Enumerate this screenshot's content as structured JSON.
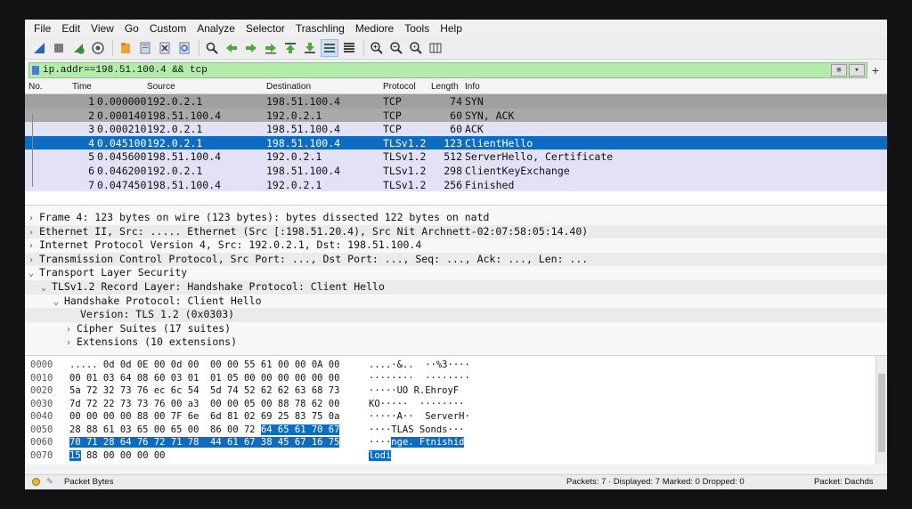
{
  "menu": [
    "File",
    "Edit",
    "View",
    "Go",
    "Custom",
    "Analyze",
    "Selector",
    "Traschling",
    "Mediore",
    "Tools",
    "Help"
  ],
  "filter": {
    "value": "ip.addr==198.51.100.4 && tcp"
  },
  "columns": {
    "no": "No.",
    "time": "Time",
    "source": "Source",
    "destination": "Destination",
    "protocol": "Protocol",
    "length": "Length",
    "info": "Info"
  },
  "packets": [
    {
      "no": "1",
      "time": "0.000000",
      "src": "192.0.2.1",
      "dst": "198.51.100.4",
      "proto": "TCP",
      "len": "74",
      "info": "SYN"
    },
    {
      "no": "2",
      "time": "0.000140",
      "src": "198.51.100.4",
      "dst": "192.0.2.1",
      "proto": "TCP",
      "len": "60",
      "info": "SYN, ACK"
    },
    {
      "no": "3",
      "time": "0.000210",
      "src": "192.0.2.1",
      "dst": "198.51.100.4",
      "proto": "TCP",
      "len": "60",
      "info": "ACK"
    },
    {
      "no": "4",
      "time": "0.045100",
      "src": "192.0.2.1",
      "dst": "198.51.100.4",
      "proto": "TLSv1.2",
      "len": "123",
      "info": "ClientHello"
    },
    {
      "no": "5",
      "time": "0.045600",
      "src": "198.51.100.4",
      "dst": "192.0.2.1",
      "proto": "TLSv1.2",
      "len": "512",
      "info": "ServerHello, Certificate"
    },
    {
      "no": "6",
      "time": "0.046200",
      "src": "192.0.2.1",
      "dst": "198.51.100.4",
      "proto": "TLSv1.2",
      "len": "298",
      "info": "ClientKeyExchange"
    },
    {
      "no": "7",
      "time": "0.047450",
      "src": "198.51.100.4",
      "dst": "192.0.2.1",
      "proto": "TLSv1.2",
      "len": "256",
      "info": "Finished"
    }
  ],
  "details": [
    "Frame 4: 123 bytes on wire (123 bytes): bytes dissected 122 bytes on natd",
    "Ethernet II, Src: ..... Ethernet (Src [:198.51.20.4), Src Nit Archnett-02:07:58:05:14.40)",
    "Internet Protocol Version 4, Src: 192.0.2.1, Dst: 198.51.100.4",
    "Transmission Control Protocol, Src Port: ..., Dst Port: ..., Seq: ..., Ack: ..., Len: ...",
    "Transport Layer Security",
    "TLSv1.2 Record Layer: Handshake Protocol: Client Hello",
    "Handshake Protocol: Client Hello",
    "Version: TLS 1.2 (0x0303)",
    "Cipher Suites (17 suites)",
    "Extensions (10 extensions)"
  ],
  "bytes": [
    {
      "off": "0000",
      "hex": "..... 0d 0d 0E 00 0d 00  00 00 55 61 00 00 0A 00",
      "hexSel": "",
      "hexRest": "",
      "asc": "....·&..  ··%3····",
      "ascSel": ""
    },
    {
      "off": "0010",
      "hex": "00 01 03 64 08 60 03 01  01 05 00 00 00 00 00 00",
      "hexSel": "",
      "hexRest": "",
      "asc": "········  ········",
      "ascSel": ""
    },
    {
      "off": "0020",
      "hex": "5a 72 32 73 76 ec 6c 54  5d 74 52 62 62 63 68 73",
      "hexSel": "",
      "hexRest": "",
      "asc": "·····UO R.EhroyF",
      "ascSel": ""
    },
    {
      "off": "0030",
      "hex": "7d 72 22 73 73 76 00 a3  00 00 05 00 88 78 62 00",
      "hexSel": "",
      "hexRest": "",
      "asc": "KO·····  ········",
      "ascSel": ""
    },
    {
      "off": "0040",
      "hex": "00 00 00 00 88 00 7F 6e  6d 81 02 69 25 83 75 0a",
      "hexSel": "",
      "hexRest": "",
      "asc": "·····A··  ServerH·",
      "ascSel": ""
    },
    {
      "off": "0050",
      "hex": "28 88 61 03 65 00 65 00  86 00 72 ",
      "hexSel": "64 65 61 70 67",
      "hexRest": "",
      "asc": "····TLAS Sonds···",
      "ascSel": ""
    },
    {
      "off": "0060",
      "hex": "",
      "hexSel": "70 71 28 64 76 72 71 78  44 61 67 38 45 67 16 75",
      "hexRest": "",
      "asc": "····",
      "ascSel": "nge. Ftnishid"
    },
    {
      "off": "0070",
      "hex": "",
      "hexSel": "15",
      "hexRest": " 88 00 00 00 00",
      "asc": "",
      "ascSel": "lodi"
    }
  ],
  "status": {
    "left": "Packet Bytes",
    "middle": "Packets: 7 · Displayed: 7 Marked: 0 Dropped: 0",
    "right": "Packet: Dachds"
  },
  "colors": {
    "selection": "#0b6cc1",
    "tcp_row": "#a0a0a0",
    "tls_row": "#e3e1f6",
    "filter_ok": "#b4ecac"
  }
}
